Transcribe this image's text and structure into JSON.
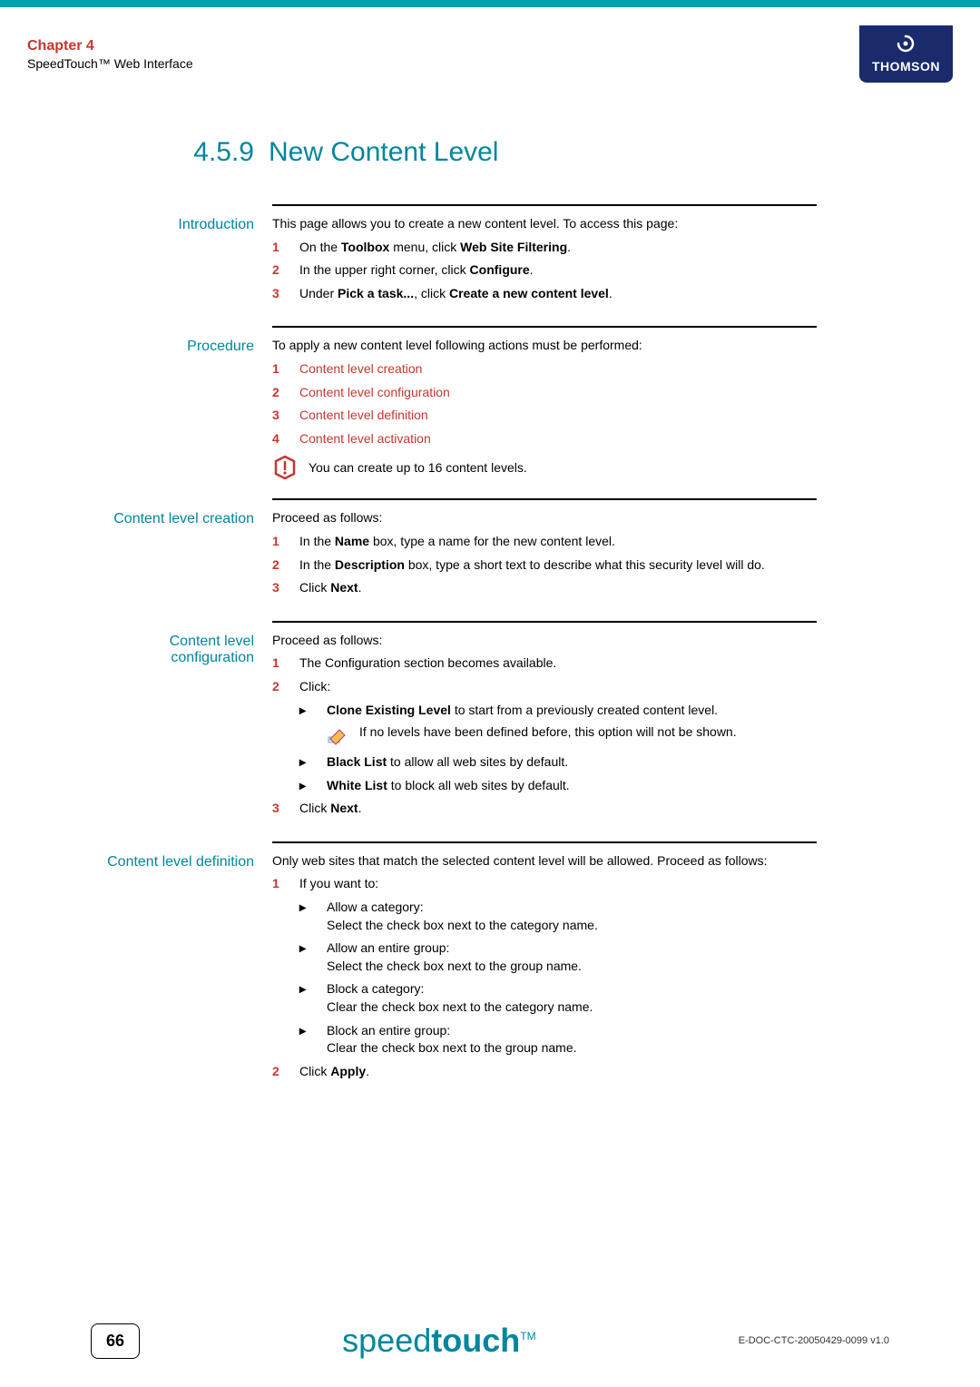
{
  "header": {
    "chapter": "Chapter 4",
    "subtitle": "SpeedTouch™ Web Interface",
    "brand": "THOMSON"
  },
  "title": {
    "number": "4.5.9",
    "text": "New Content Level"
  },
  "introduction": {
    "label": "Introduction",
    "lead": "This page allows you to create a new content level. To access this page:",
    "steps": [
      {
        "num": "1",
        "pre": "On the ",
        "b1": "Toolbox",
        "mid": " menu, click ",
        "b2": "Web Site Filtering",
        "post": "."
      },
      {
        "num": "2",
        "pre": "In the upper right corner, click ",
        "b1": "Configure",
        "post": "."
      },
      {
        "num": "3",
        "pre": "Under ",
        "b1": "Pick a task...",
        "mid": ", click ",
        "b2": "Create a new content level",
        "post": "."
      }
    ]
  },
  "procedure": {
    "label": "Procedure",
    "lead": "To apply a new content level following actions must be performed:",
    "steps": [
      {
        "num": "1",
        "text": "Content level creation"
      },
      {
        "num": "2",
        "text": "Content level configuration"
      },
      {
        "num": "3",
        "text": "Content level definition"
      },
      {
        "num": "4",
        "text": "Content level activation"
      }
    ],
    "note": "You can create up to 16 content levels."
  },
  "creation": {
    "label": "Content level creation",
    "lead": "Proceed as follows:",
    "steps": [
      {
        "num": "1",
        "pre": "In the ",
        "b1": "Name",
        "post": " box, type a name for the new content level."
      },
      {
        "num": "2",
        "pre": "In the ",
        "b1": "Description",
        "post": " box, type a short text to describe what this security level will do."
      },
      {
        "num": "3",
        "pre": "Click ",
        "b1": "Next",
        "post": "."
      }
    ]
  },
  "configuration": {
    "label_l1": "Content level",
    "label_l2": "configuration",
    "lead": "Proceed as follows:",
    "step1": {
      "num": "1",
      "text": "The Configuration section becomes available."
    },
    "step2": {
      "num": "2",
      "text": "Click:"
    },
    "bullet1": {
      "b": "Clone Existing Level",
      "rest": " to start from a previously created content level."
    },
    "note": "If no levels have been defined before, this option will not be shown.",
    "bullet2": {
      "b": "Black List",
      "rest": " to allow all web sites by default."
    },
    "bullet3": {
      "b": "White List",
      "rest": " to block all web sites by default."
    },
    "step3": {
      "num": "3",
      "pre": "Click ",
      "b": "Next",
      "post": "."
    }
  },
  "definition": {
    "label": "Content level definition",
    "lead": "Only web sites that match the selected content level will be allowed. Proceed as follows:",
    "step1": {
      "num": "1",
      "text": "If you want to:"
    },
    "bullets": [
      {
        "title": "Allow a category:",
        "desc": "Select the check box next to the category name."
      },
      {
        "title": "Allow an entire group:",
        "desc": "Select the check box next to the group name."
      },
      {
        "title": "Block a category:",
        "desc": "Clear the check box next to the category name."
      },
      {
        "title": "Block an entire group:",
        "desc": "Clear the check box next to the group name."
      }
    ],
    "step2": {
      "num": "2",
      "pre": "Click ",
      "b": "Apply",
      "post": "."
    }
  },
  "footer": {
    "page": "66",
    "logo_pre": "speed",
    "logo_bold": "touch",
    "logo_tm": "TM",
    "docid": "E-DOC-CTC-20050429-0099 v1.0"
  }
}
